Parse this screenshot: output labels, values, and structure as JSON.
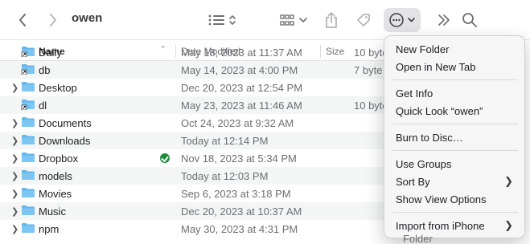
{
  "toolbar": {
    "title": "owen",
    "icons": [
      "back-chevron-icon",
      "forward-chevron-icon",
      "list-view-icon",
      "group-icon",
      "share-icon",
      "tag-icon",
      "more-icon",
      "overflow-icon",
      "search-icon"
    ]
  },
  "columns": {
    "name": "Name",
    "date_modified": "Date Modified",
    "size": "Size"
  },
  "files": [
    {
      "name": "Daily",
      "date": "May 18, 2023 at 11:37 AM",
      "size": "10 byte",
      "type": "alias",
      "expandable": false,
      "badge": false
    },
    {
      "name": "db",
      "date": "May 14, 2023 at 4:00 PM",
      "size": "7 byte",
      "type": "alias",
      "expandable": false,
      "badge": false
    },
    {
      "name": "Desktop",
      "date": "Dec 20, 2023 at 12:54 PM",
      "size": "",
      "type": "folder",
      "expandable": true,
      "badge": false
    },
    {
      "name": "dl",
      "date": "May 23, 2023 at 11:46 AM",
      "size": "10 byte",
      "type": "alias",
      "expandable": false,
      "badge": false
    },
    {
      "name": "Documents",
      "date": "Oct 24, 2023 at 9:32 AM",
      "size": "",
      "type": "folder",
      "expandable": true,
      "badge": false
    },
    {
      "name": "Downloads",
      "date": "Today at 12:14 PM",
      "size": "",
      "type": "folder",
      "expandable": true,
      "badge": false
    },
    {
      "name": "Dropbox",
      "date": "Nov 18, 2023 at 5:34 PM",
      "size": "",
      "type": "folder",
      "expandable": true,
      "badge": true
    },
    {
      "name": "models",
      "date": "Today at 12:03 PM",
      "size": "",
      "type": "folder",
      "expandable": true,
      "badge": false
    },
    {
      "name": "Movies",
      "date": "Sep 6, 2023 at 3:18 PM",
      "size": "",
      "type": "folder",
      "expandable": true,
      "badge": false
    },
    {
      "name": "Music",
      "date": "Dec 20, 2023 at 10:37 AM",
      "size": "",
      "type": "folder",
      "expandable": true,
      "badge": false
    },
    {
      "name": "npm",
      "date": "May 30, 2023 at 4:31 PM",
      "size": "",
      "type": "folder",
      "expandable": true,
      "badge": false
    }
  ],
  "menu": {
    "new_folder": "New Folder",
    "open_new_tab": "Open in New Tab",
    "get_info": "Get Info",
    "quick_look": "Quick Look “owen”",
    "burn": "Burn to Disc…",
    "use_groups": "Use Groups",
    "sort_by": "Sort By",
    "show_view_options": "Show View Options",
    "import_iphone": "Import from iPhone"
  },
  "behind_text": "Folder",
  "colors": {
    "folder_blue": "#62b7ee",
    "badge_green": "#1d8a3b"
  }
}
